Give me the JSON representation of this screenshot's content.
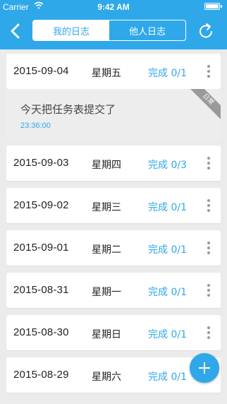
{
  "status_bar": {
    "carrier": "Carrier",
    "time": "9:42 AM"
  },
  "header": {
    "tabs": [
      {
        "label": "我的日志",
        "active": true
      },
      {
        "label": "他人日志",
        "active": false
      }
    ],
    "back_icon": "chevron-left-icon",
    "refresh_icon": "refresh-icon"
  },
  "logs": [
    {
      "date": "2015-09-04",
      "weekday": "星期五",
      "status": "完成 0/1"
    },
    {
      "date": "2015-09-03",
      "weekday": "星期四",
      "status": "完成 0/3"
    },
    {
      "date": "2015-09-02",
      "weekday": "星期三",
      "status": "完成 0/1"
    },
    {
      "date": "2015-09-01",
      "weekday": "星期二",
      "status": "完成 0/1"
    },
    {
      "date": "2015-08-31",
      "weekday": "星期一",
      "status": "完成 0/1"
    },
    {
      "date": "2015-08-30",
      "weekday": "星期日",
      "status": "完成 0/1"
    },
    {
      "date": "2015-08-29",
      "weekday": "星期六",
      "status": "完成 0/1"
    }
  ],
  "expanded_entry": {
    "text": "今天把任务表提交了",
    "time": "23:36:00",
    "tag": "日常"
  },
  "colors": {
    "primary": "#2fa8ea",
    "background": "#ebebeb"
  }
}
